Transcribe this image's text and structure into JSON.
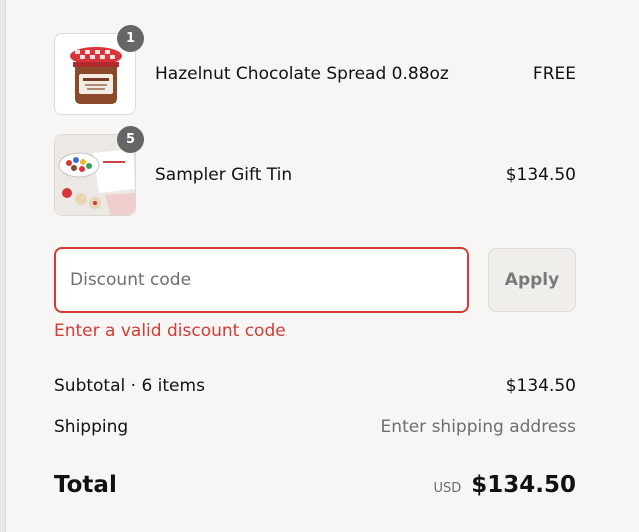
{
  "line_items": [
    {
      "quantity": "1",
      "title": "Hazelnut Chocolate Spread 0.88oz",
      "price": "FREE"
    },
    {
      "quantity": "5",
      "title": "Sampler Gift Tin",
      "price": "$134.50"
    }
  ],
  "discount": {
    "placeholder": "Discount code",
    "value": "",
    "apply_label": "Apply",
    "error": "Enter a valid discount code"
  },
  "summary": {
    "subtotal_label": "Subtotal · 6 items",
    "subtotal_value": "$134.50",
    "shipping_label": "Shipping",
    "shipping_value": "Enter shipping address",
    "total_label": "Total",
    "currency": "USD",
    "total_value": "$134.50"
  },
  "colors": {
    "error": "#d33b35",
    "badge": "#666666",
    "background": "#f7f6f5"
  }
}
